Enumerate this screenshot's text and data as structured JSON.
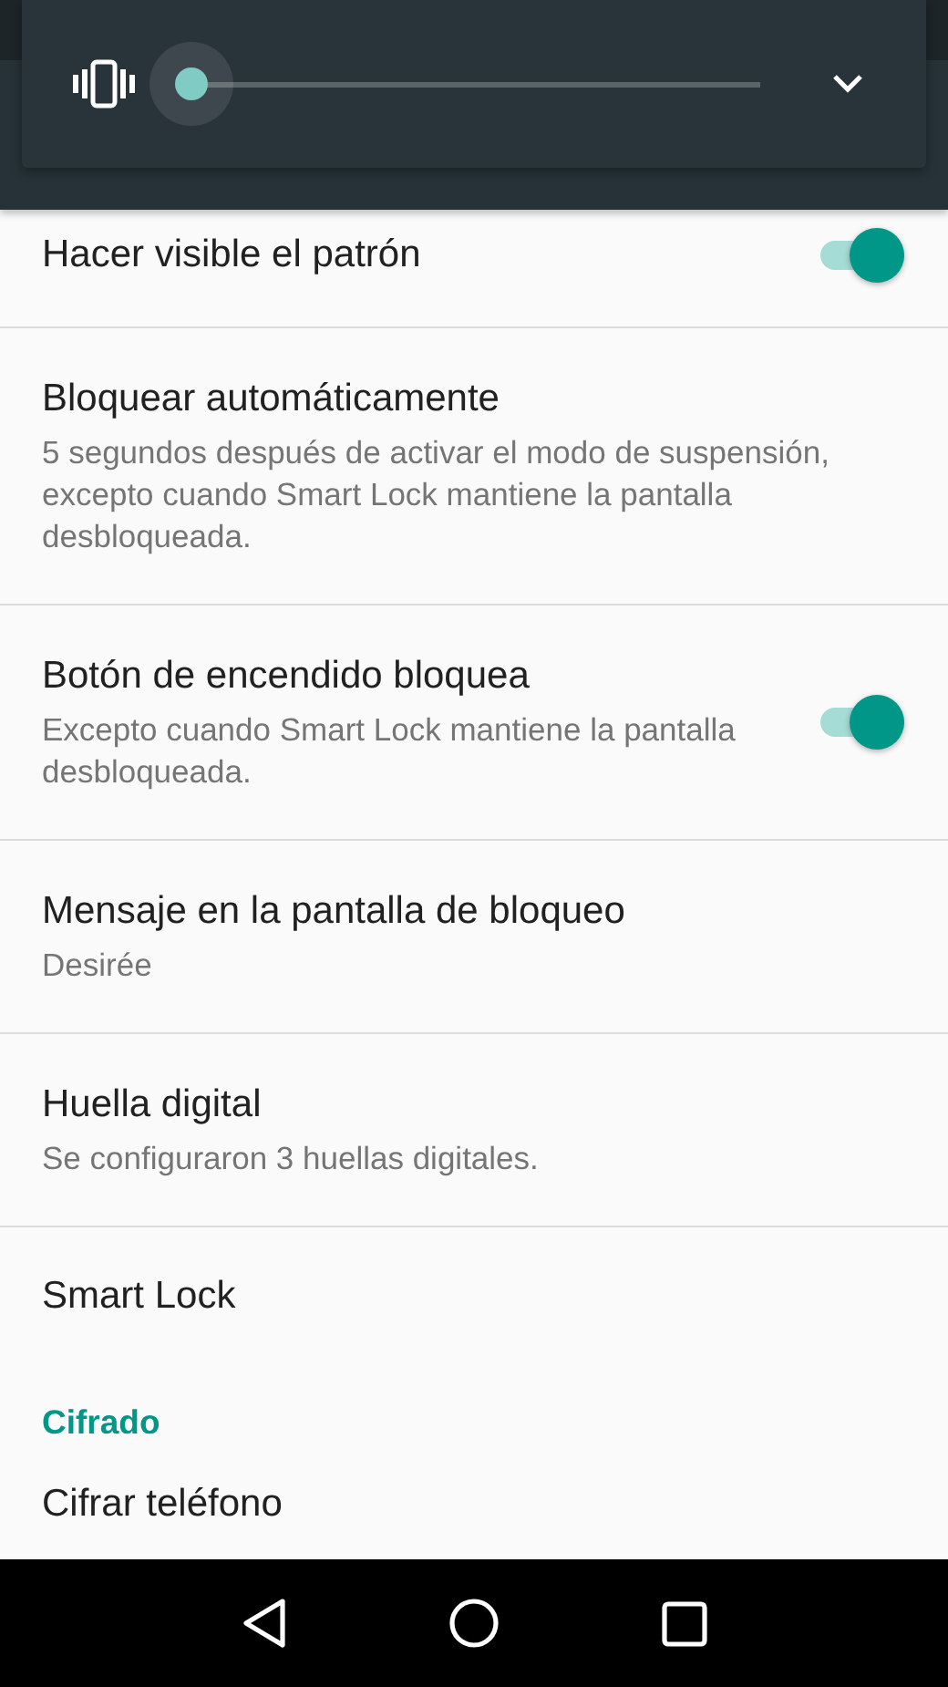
{
  "volume_panel": {
    "expanded": false
  },
  "settings": [
    {
      "kind": "toggle",
      "title": "Hacer visible el patrón",
      "on": true
    },
    {
      "kind": "text",
      "title": "Bloquear automáticamente",
      "summary": "5 segundos después de activar el modo de suspensión, excepto cuando Smart Lock mantiene la pantalla desbloqueada."
    },
    {
      "kind": "toggle",
      "title": "Botón de encendido bloquea",
      "summary": "Excepto cuando Smart Lock mantiene la pantalla desbloqueada.",
      "on": true
    },
    {
      "kind": "text",
      "title": "Mensaje en la pantalla de bloqueo",
      "summary": "Desirée"
    },
    {
      "kind": "text",
      "title": "Huella digital",
      "summary": "Se configuraron 3 huellas digitales."
    },
    {
      "kind": "text",
      "title": "Smart Lock"
    },
    {
      "kind": "header",
      "title": "Cifrado"
    },
    {
      "kind": "text",
      "title": "Cifrar teléfono"
    }
  ]
}
